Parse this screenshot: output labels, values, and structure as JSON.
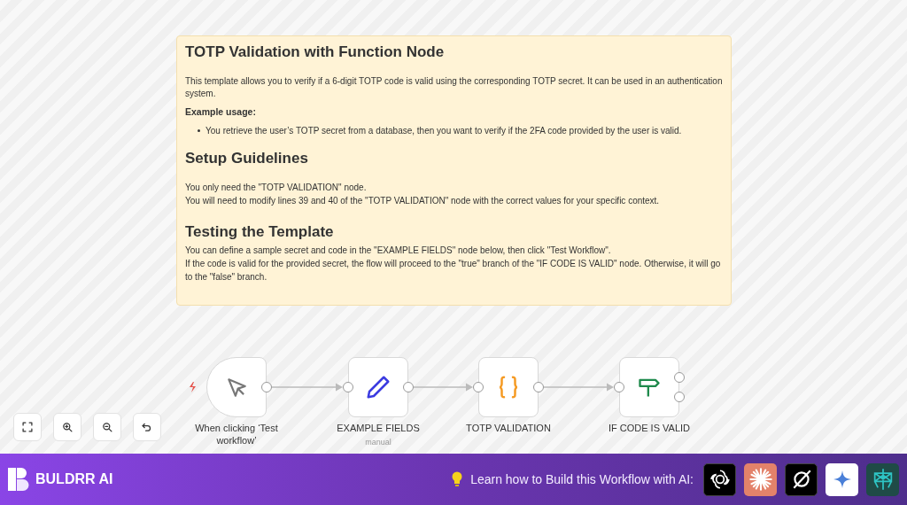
{
  "note": {
    "title": "TOTP Validation with Function Node",
    "intro": "This template allows you to verify if a 6-digit TOTP code is valid using the corresponding TOTP secret. It can be used in an authentication system.",
    "example_heading": "Example usage:",
    "bullets": [
      "You retrieve the user’s TOTP secret from a database, then you want to verify if the 2FA code provided by the user is valid."
    ],
    "sections": [
      {
        "heading": "Setup Guidelines",
        "lines": [
          "You only need the \"TOTP VALIDATION\" node.",
          "You will need to modify lines 39 and 40 of the \"TOTP VALIDATION\" node with the correct values for your specific context."
        ]
      },
      {
        "heading": "Testing the Template",
        "lines": [
          "You can define a sample secret and code in the \"EXAMPLE FIELDS\" node below, then click \"Test Workflow\".",
          "If the code is valid for the provided secret, the flow will proceed to the \"true\" branch of the \"IF CODE IS VALID\" node. Otherwise, it will go to the \"false\" branch."
        ]
      }
    ]
  },
  "nodes": [
    {
      "kind": "trigger",
      "label": "When clicking ‘Test workflow’"
    },
    {
      "kind": "set",
      "label": "EXAMPLE FIELDS",
      "sublabel": "manual"
    },
    {
      "kind": "code",
      "label": "TOTP VALIDATION"
    },
    {
      "kind": "if",
      "label": "IF CODE IS VALID"
    }
  ],
  "footer": {
    "brand": "BULDRR AI",
    "prompt": "Learn how to Build this Workflow with AI:"
  }
}
